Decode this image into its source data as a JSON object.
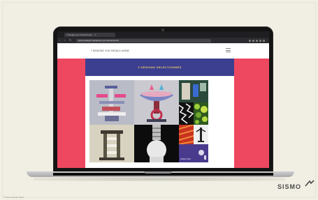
{
  "browser": {
    "tab_title": "7 Designs you should know",
    "tab_close": "×",
    "url": "sismo.design/7-designers-you-should-know",
    "nav_back": "‹",
    "nav_forward": "›",
    "reload": "↻"
  },
  "site": {
    "header_name": "7 DESIGNS YOU SHOULD KNOW",
    "banner_title": "3 DESIGNS SELECTIONNÉS",
    "tile_label": "Carlton Tulip",
    "colors": {
      "page_bg": "#ee4760",
      "banner_bg": "#3c3f8f",
      "banner_text": "#e9c86a"
    }
  },
  "footer": {
    "logo": "SISMO",
    "caption": "© Sismo design 2020"
  }
}
